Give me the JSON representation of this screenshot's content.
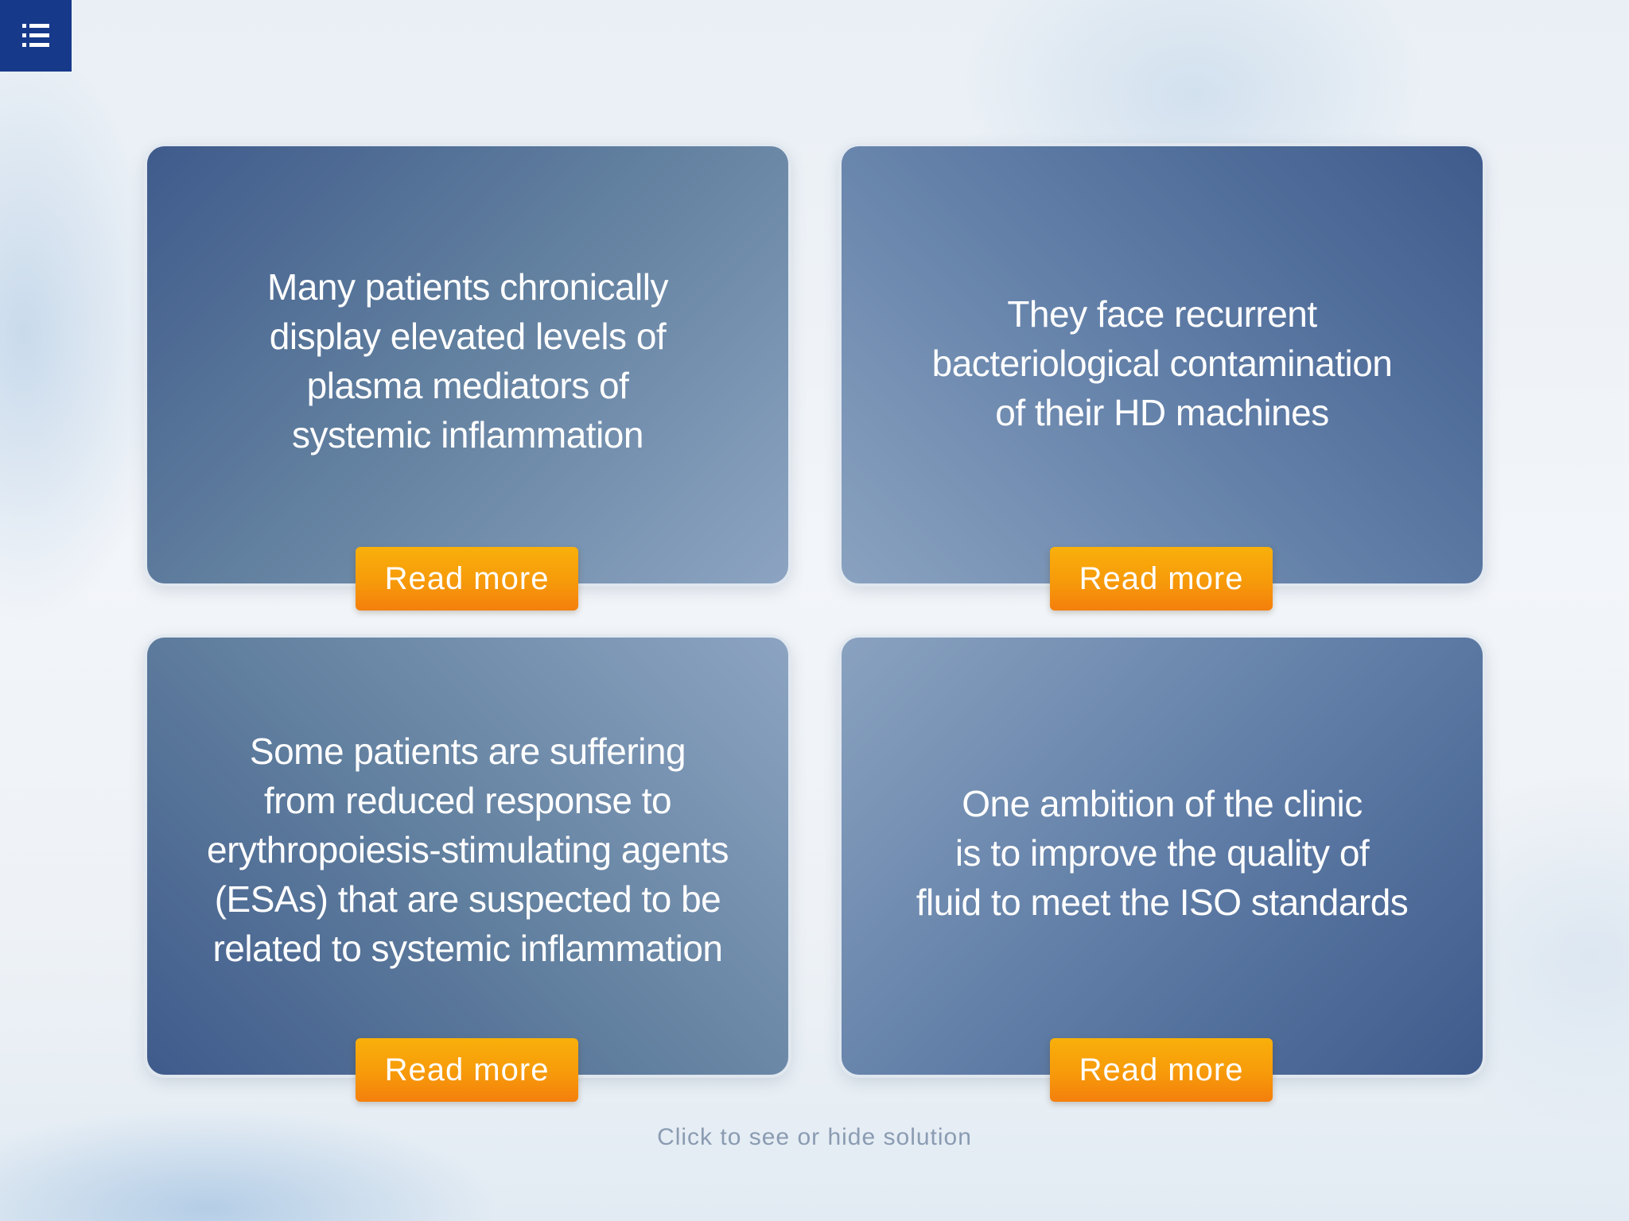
{
  "menu": {
    "icon": "list-menu-icon",
    "color": "#17398a"
  },
  "cards": [
    {
      "text": "Many patients chronically\ndisplay elevated levels of\nplasma mediators of\nsystemic inflammation",
      "button_label": "Read more"
    },
    {
      "text": "They face recurrent\nbacteriological contamination\nof their HD machines",
      "button_label": "Read more"
    },
    {
      "text": "Some patients are suffering\nfrom reduced response to\nerythropoiesis-stimulating agents\n(ESAs) that are suspected to be\nrelated to systemic inflammation",
      "button_label": "Read more"
    },
    {
      "text": "One ambition of the clinic\nis to improve the quality of\nfluid to meet the ISO standards",
      "button_label": "Read more"
    }
  ],
  "hint_text": "Click to see or hide solution",
  "colors": {
    "accent_orange": "#f79a0a",
    "card_blue_dark": "#3f5b8c",
    "card_blue_light": "#8ca4c2",
    "hint_gray": "#8a9bb2"
  }
}
